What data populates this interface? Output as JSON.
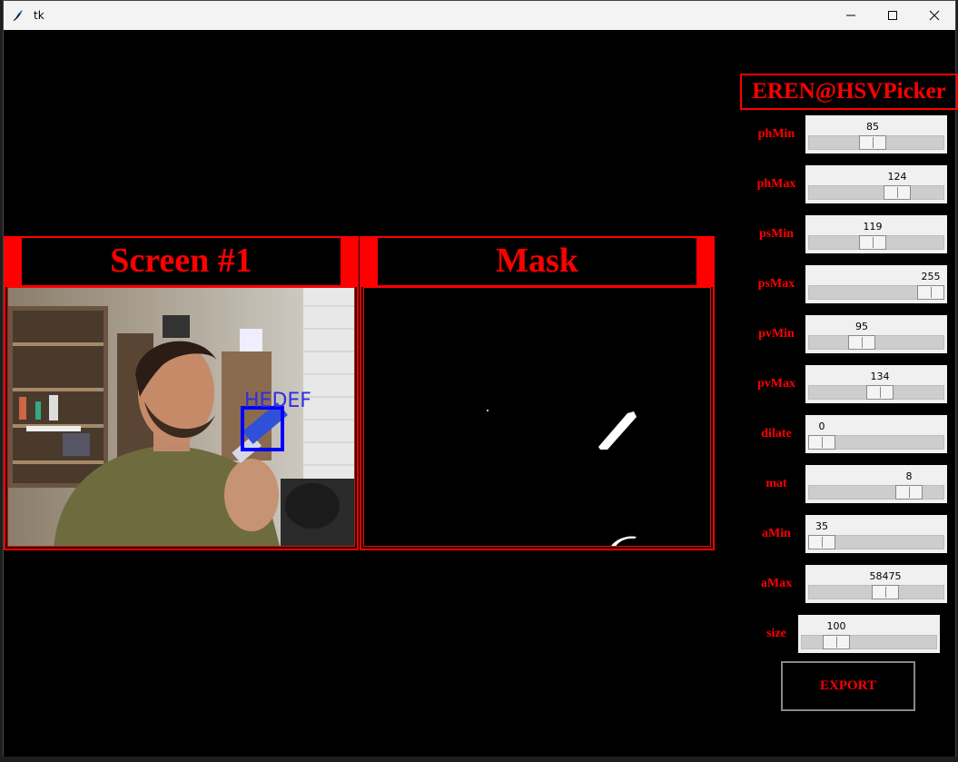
{
  "window": {
    "title": "tk"
  },
  "brand": {
    "text": "EREN@HSVPicker"
  },
  "screen_panel": {
    "title": "Screen #1",
    "overlay_text": "HEDEF"
  },
  "mask_panel": {
    "title": "Mask"
  },
  "sliders": [
    {
      "label": "phMin",
      "value": "85",
      "fraction": 0.47
    },
    {
      "label": "phMax",
      "value": "124",
      "fraction": 0.69
    },
    {
      "label": "psMin",
      "value": "119",
      "fraction": 0.47
    },
    {
      "label": "psMax",
      "value": "255",
      "fraction": 1.0
    },
    {
      "label": "pvMin",
      "value": "95",
      "fraction": 0.37
    },
    {
      "label": "pvMax",
      "value": "134",
      "fraction": 0.53
    },
    {
      "label": "dilate",
      "value": "0",
      "fraction": 0.0
    },
    {
      "label": "mat",
      "value": "8",
      "fraction": 0.8
    },
    {
      "label": "aMin",
      "value": "35",
      "fraction": 0.0
    },
    {
      "label": "aMax",
      "value": "58475",
      "fraction": 0.58
    },
    {
      "label": "size",
      "value": "100",
      "fraction": 0.2
    }
  ],
  "export": {
    "label": "EXPORT"
  },
  "colors": {
    "accent": "#ff0000",
    "background": "#000000",
    "scale_bg": "#f0f0f0"
  },
  "icons": {
    "app": "feather-icon",
    "minimize": "minimize-icon",
    "maximize": "maximize-icon",
    "close": "close-icon"
  }
}
